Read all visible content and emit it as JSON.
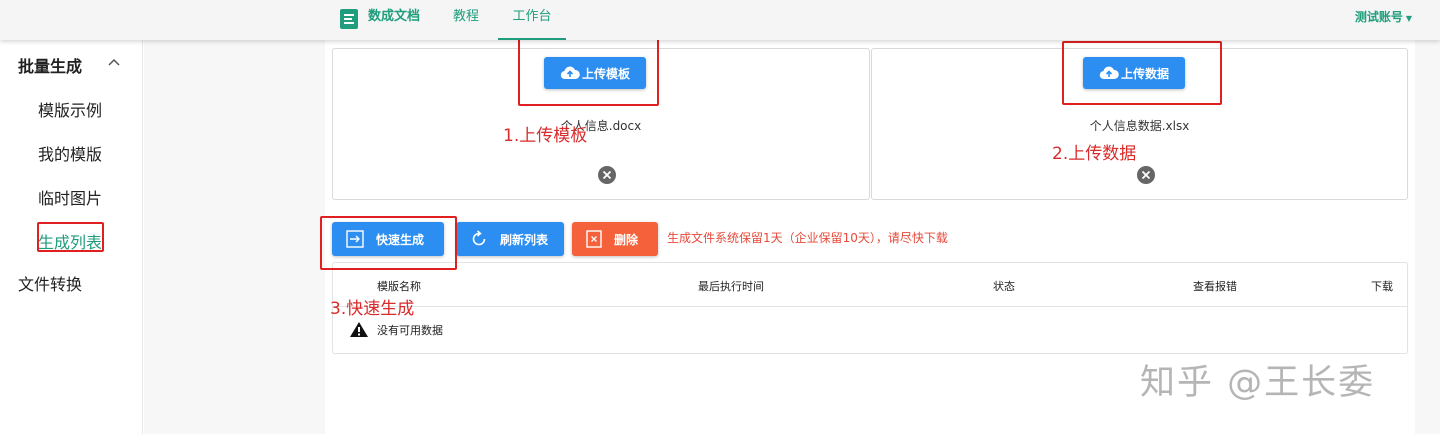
{
  "topbar": {
    "brand": "数成文档",
    "tutorial": "教程",
    "workbench": "工作台",
    "account": "测试账号",
    "accent_color": "#1f9d7c"
  },
  "sidebar": {
    "group1": "批量生成",
    "items": [
      "模版示例",
      "我的模版",
      "临时图片",
      "生成列表"
    ],
    "group2": "文件转换"
  },
  "upload": {
    "template_button": "上传模板",
    "template_file": "个人信息.docx",
    "data_button": "上传数据",
    "data_file": "个人信息数据.xlsx"
  },
  "actions": {
    "quick_generate": "快速生成",
    "refresh_list": "刷新列表",
    "delete": "删除",
    "notice": "生成文件系统保留1天（企业保留10天），请尽快下载"
  },
  "table": {
    "columns": [
      "模版名称",
      "最后执行时间",
      "状态",
      "查看报错",
      "下载"
    ],
    "empty_text": "没有可用数据"
  },
  "annotations": {
    "step1": "1.上传模板",
    "step2": "2.上传数据",
    "step3": "3.快速生成"
  },
  "watermark": "知乎 @王长委"
}
